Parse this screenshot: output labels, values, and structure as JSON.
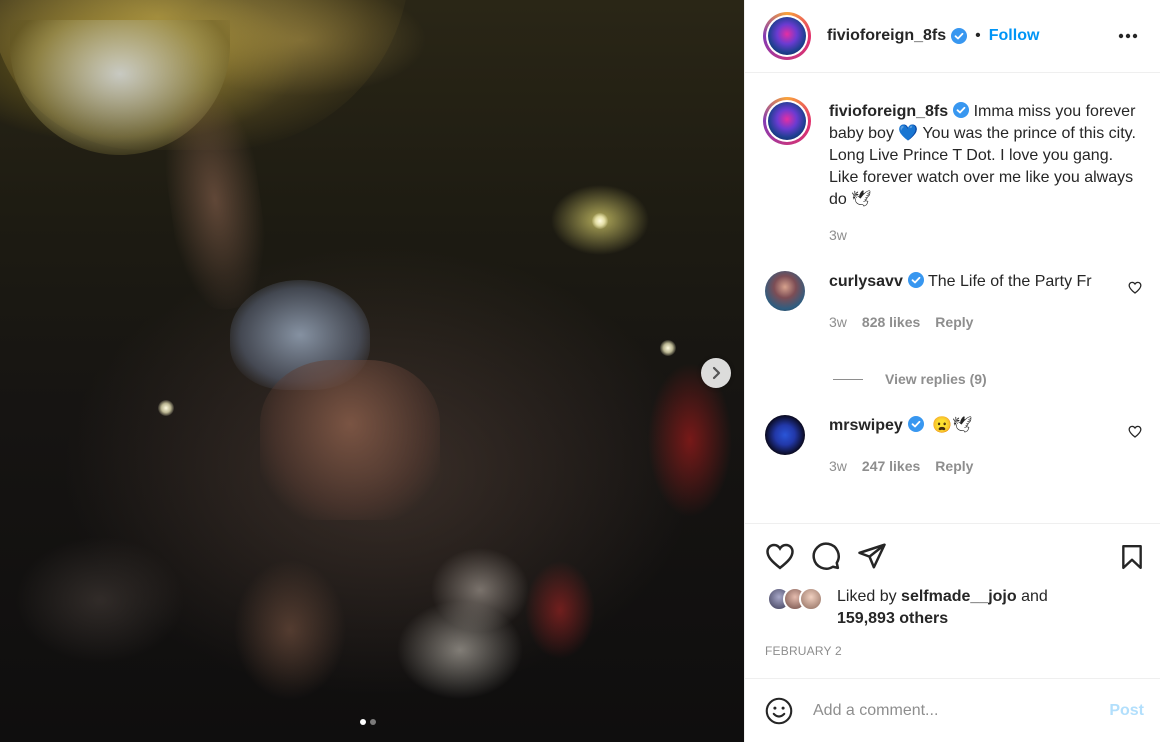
{
  "post": {
    "username": "fivioforeign_8fs",
    "follow_label": "Follow",
    "caption": "Imma miss you forever baby boy 💙 You was the prince of this city. Long Live Prince T Dot. I love you gang. Like forever watch over me like you always do 🕊",
    "caption_time": "3w",
    "liked_by_prefix": "Liked by",
    "liked_by_user": "selfmade__jojo",
    "liked_by_and": "and",
    "liked_by_count": "159,893 others",
    "date": "FEBRUARY 2"
  },
  "media": {
    "slide_count": 2,
    "active_slide": 1
  },
  "comments": [
    {
      "username": "curlysavv",
      "text": "The Life of the Party Fr",
      "time": "3w",
      "likes": "828 likes",
      "reply_label": "Reply",
      "view_replies": "View replies (9)"
    },
    {
      "username": "mrswipey",
      "text": "😦🕊",
      "time": "3w",
      "likes": "247 likes",
      "reply_label": "Reply"
    }
  ],
  "composer": {
    "placeholder": "Add a comment...",
    "post_label": "Post"
  },
  "colors": {
    "accent": "#0095f6",
    "verified": "#3897f0",
    "muted": "#8e8e8e",
    "post_disabled": "#b2dffc"
  },
  "icons": {
    "header_more": "more-horizontal-icon",
    "next": "chevron-right-icon",
    "like": "heart-icon",
    "comment": "comment-bubble-icon",
    "share": "paper-plane-icon",
    "save": "bookmark-icon",
    "emoji": "smiley-icon",
    "verified": "verified-badge-icon"
  }
}
